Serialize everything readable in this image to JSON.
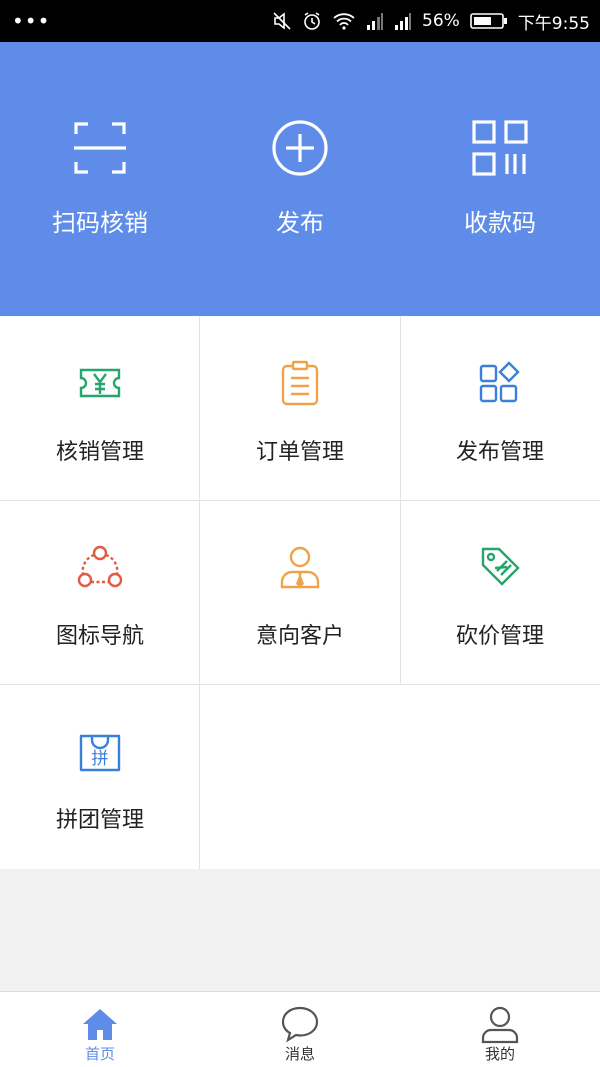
{
  "status_bar": {
    "menu_dots": "•••",
    "battery_percent": "56%",
    "time": "下午9:55"
  },
  "hero": {
    "scan": {
      "label": "扫码核销",
      "icon": "scan-icon"
    },
    "publish": {
      "label": "发布",
      "icon": "plus-circle-icon"
    },
    "payment_code": {
      "label": "收款码",
      "icon": "qr-code-icon"
    }
  },
  "grid": {
    "verify": {
      "label": "核销管理",
      "icon": "ticket-yen-icon",
      "color": "#27a46d"
    },
    "orders": {
      "label": "订单管理",
      "icon": "clipboard-icon",
      "color": "#f0a24a"
    },
    "publish": {
      "label": "发布管理",
      "icon": "apps-diamond-icon",
      "color": "#3a7fd8"
    },
    "nav": {
      "label": "图标导航",
      "icon": "network-icon",
      "color": "#e05a44"
    },
    "customers": {
      "label": "意向客户",
      "icon": "person-tie-icon",
      "color": "#f0a24a"
    },
    "bargain": {
      "label": "砍价管理",
      "icon": "price-tag-icon",
      "color": "#27a46d"
    },
    "group": {
      "label": "拼团管理",
      "icon": "group-bag-icon",
      "color": "#3a7fd8",
      "icon_text": "拼"
    }
  },
  "tabbar": {
    "home": {
      "label": "首页",
      "active": true
    },
    "messages": {
      "label": "消息"
    },
    "mine": {
      "label": "我的"
    }
  },
  "colors": {
    "hero_bg": "#5e8ce8",
    "active_tab": "#5e8ce8",
    "inactive_tab": "#555555"
  }
}
